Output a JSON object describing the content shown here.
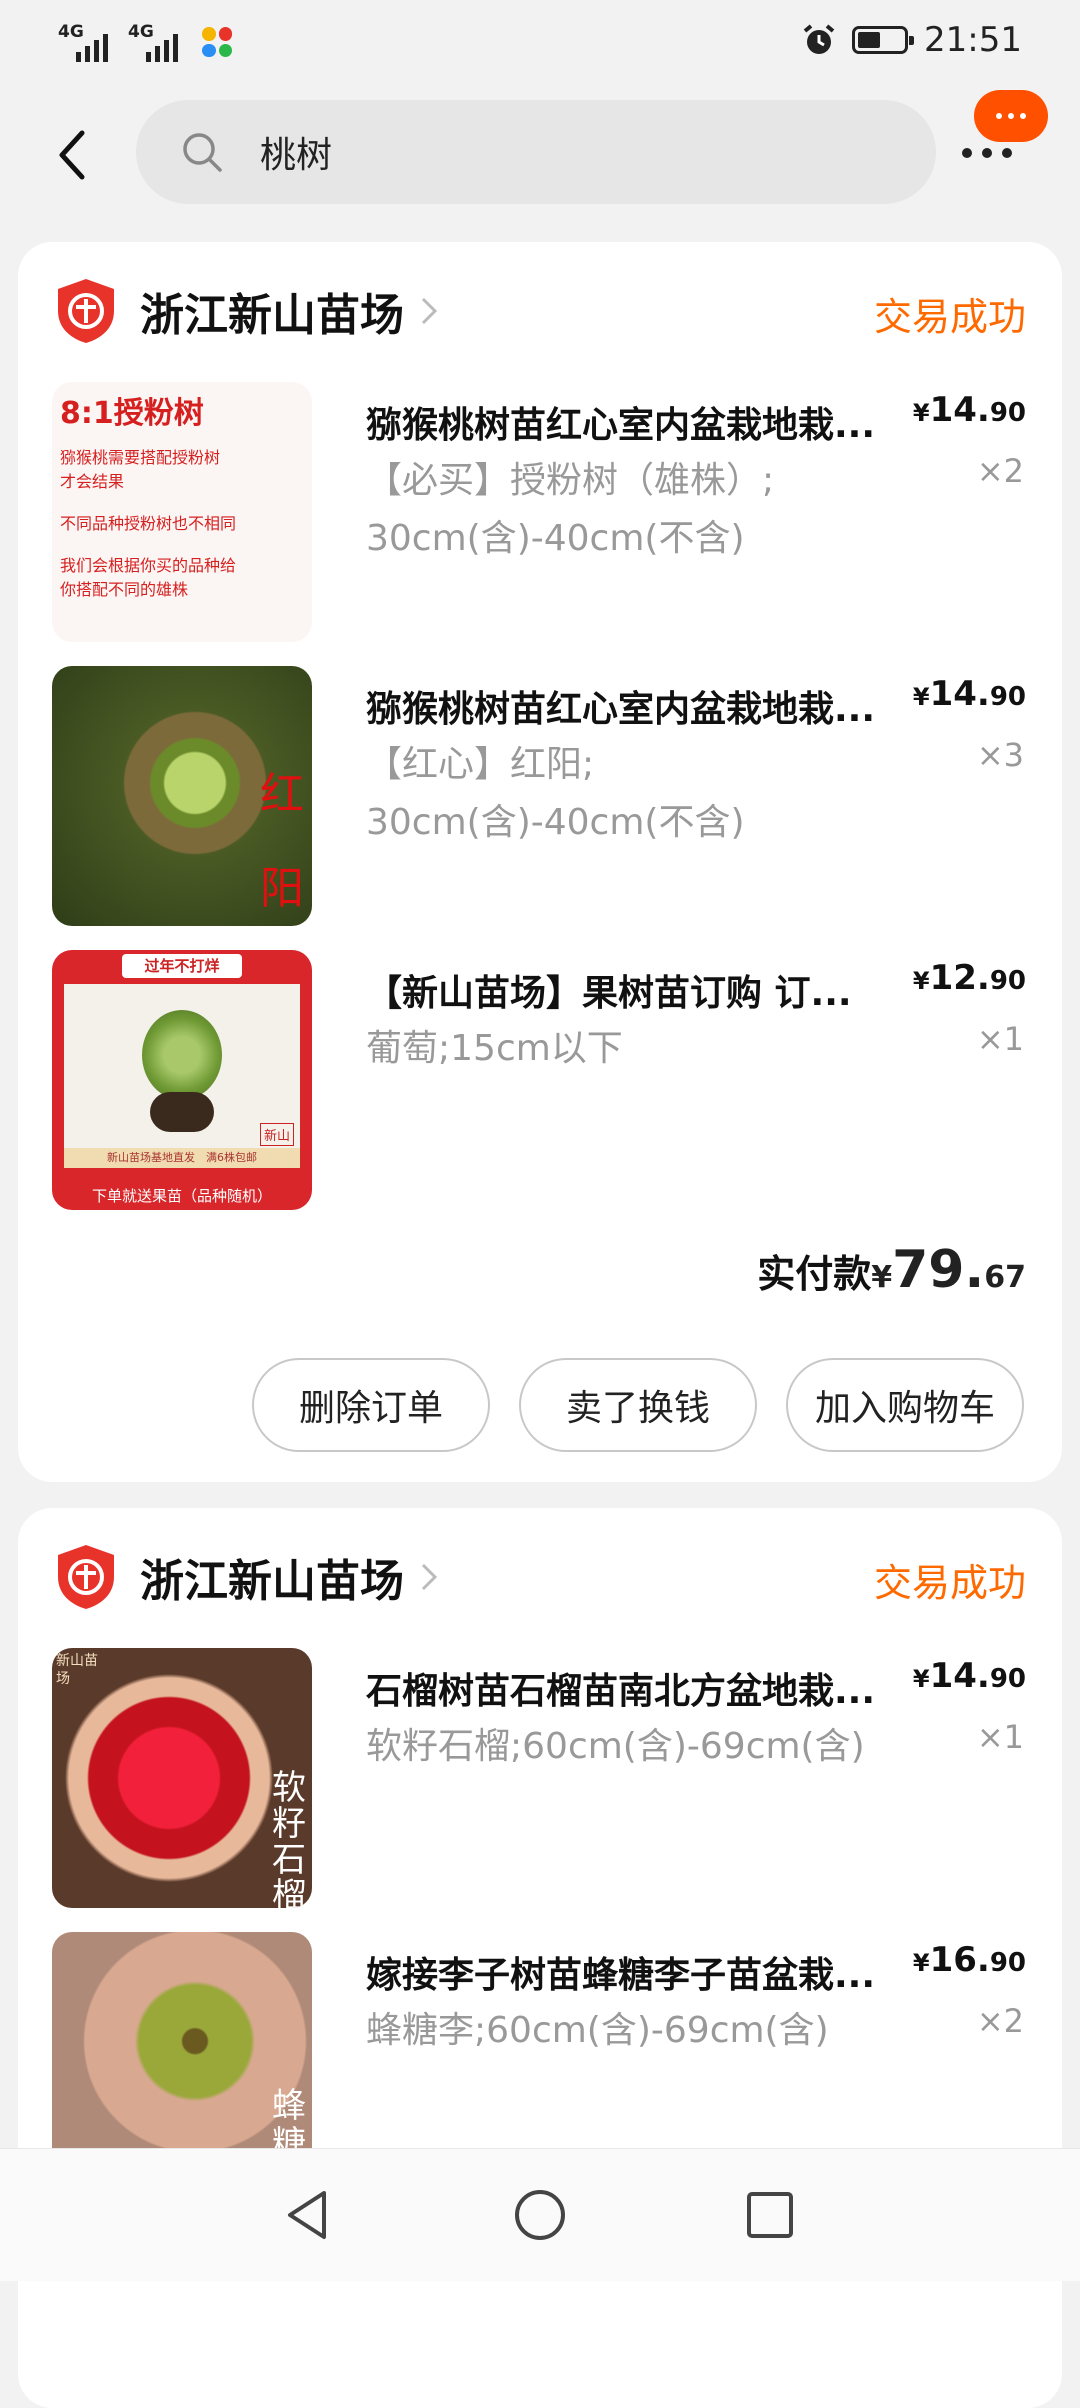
{
  "status_bar": {
    "network_1": "4G",
    "network_2": "4G",
    "time": "21:51",
    "icons": [
      "signal-icon",
      "signal-icon",
      "app-notification-icon",
      "alarm-icon",
      "battery-icon"
    ]
  },
  "search": {
    "query": "桃树",
    "icons": [
      "back-arrow-icon",
      "search-icon",
      "more-menu-icon"
    ]
  },
  "colors": {
    "accent": "#ff6a00",
    "brand": "#ff5000",
    "shop_logo": "#e8332a",
    "muted": "#999999"
  },
  "orders": [
    {
      "shop_name": "浙江新山苗场",
      "status": "交易成功",
      "items": [
        {
          "title": "猕猴桃树苗红心室内盆栽地栽...",
          "sku_lines": [
            "【必买】授粉树（雄株）;",
            "30cm(含)-40cm(不含)"
          ],
          "price_symbol": "¥",
          "price_int": "14.",
          "price_dec": "90",
          "qty": "×2",
          "thumb": {
            "heading": "8:1授粉树",
            "lines": [
              "猕猴桃需要搭配授粉树",
              "才会结果",
              "不同品种授粉树也不相同",
              "我们会根据你买的品种给",
              "你搭配不同的雄株"
            ]
          }
        },
        {
          "title": "猕猴桃树苗红心室内盆栽地栽...",
          "sku_lines": [
            "【红心】红阳;",
            "30cm(含)-40cm(不含)"
          ],
          "price_symbol": "¥",
          "price_int": "14.",
          "price_dec": "90",
          "qty": "×3",
          "thumb": {
            "overlay_1": "红",
            "overlay_2": "阳"
          }
        },
        {
          "title": "【新山苗场】果树苗订购 订...",
          "sku_lines": [
            "葡萄;15cm以下"
          ],
          "price_symbol": "¥",
          "price_int": "12.",
          "price_dec": "90",
          "qty": "×1",
          "thumb": {
            "banner": "过年不打烊",
            "brand": "新山",
            "strip": "新山苗场基地直发　满6株包邮",
            "footer": "下单就送果苗（品种随机）"
          }
        }
      ],
      "total_label": "实付款",
      "total_symbol": "¥",
      "total_int": "79.",
      "total_dec": "67",
      "buttons": [
        "删除订单",
        "卖了换钱",
        "加入购物车"
      ]
    },
    {
      "shop_name": "浙江新山苗场",
      "status": "交易成功",
      "items": [
        {
          "title": "石榴树苗石榴苗南北方盆地栽...",
          "sku_lines": [
            "软籽石榴;60cm(含)-69cm(含)"
          ],
          "price_symbol": "¥",
          "price_int": "14.",
          "price_dec": "90",
          "qty": "×1",
          "thumb": {
            "overlay_1": "软",
            "overlay_2": "籽",
            "overlay_3": "石",
            "overlay_4": "榴",
            "badge": "新山苗场"
          }
        },
        {
          "title": "嫁接李子树苗蜂糖李子苗盆栽...",
          "sku_lines": [
            "蜂糖李;60cm(含)-69cm(含)"
          ],
          "price_symbol": "¥",
          "price_int": "16.",
          "price_dec": "90",
          "qty": "×2",
          "thumb": {
            "overlay_1": "蜂",
            "overlay_2": "糖"
          }
        }
      ]
    }
  ],
  "nav": {
    "icons": [
      "nav-back-icon",
      "nav-home-icon",
      "nav-recents-icon"
    ]
  }
}
